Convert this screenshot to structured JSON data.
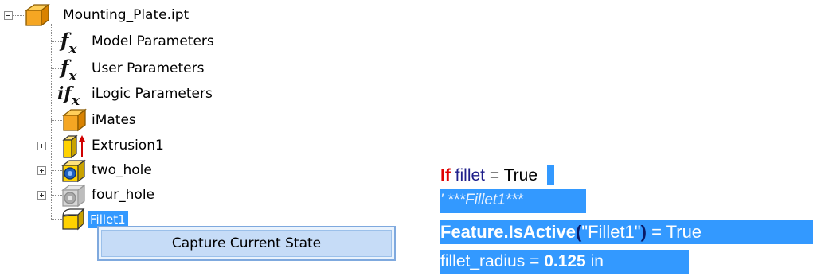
{
  "tree": {
    "root": {
      "label": "Mounting_Plate.ipt",
      "icon": "part-file-icon"
    },
    "items": [
      {
        "label": "Model Parameters",
        "icon": "fx-icon"
      },
      {
        "label": "User Parameters",
        "icon": "fx-icon"
      },
      {
        "label": "iLogic Parameters",
        "icon": "ilogic-fx-icon"
      },
      {
        "label": "iMates",
        "icon": "imates-cube-icon"
      },
      {
        "label": "Extrusion1",
        "icon": "extrusion-icon"
      },
      {
        "label": "two_hole",
        "icon": "hole-feature-icon"
      },
      {
        "label": "four_hole",
        "icon": "hole-feature-suppressed-icon"
      },
      {
        "label": "Fillet1",
        "icon": "fillet-icon",
        "selected": true
      }
    ]
  },
  "context_menu": {
    "items": [
      {
        "label": "Capture Current State"
      }
    ]
  },
  "code": {
    "line1": {
      "keyword": "If",
      "var": "fillet",
      "rest": "= True"
    },
    "line2": {
      "comment": "' ***Fillet1***"
    },
    "line3": {
      "obj": "Feature.IsActive",
      "open": "(",
      "arg": "\"Fillet1\"",
      "close": ")",
      "rest": "= True"
    },
    "line4": {
      "var": "fillet_radius",
      "eq": "=",
      "num": "0.125",
      "unit": "in"
    }
  },
  "colors": {
    "selection": "#3399ff",
    "keyword": "#e00000",
    "variable": "#1e1e8a",
    "menu_border": "#7fa9de"
  }
}
